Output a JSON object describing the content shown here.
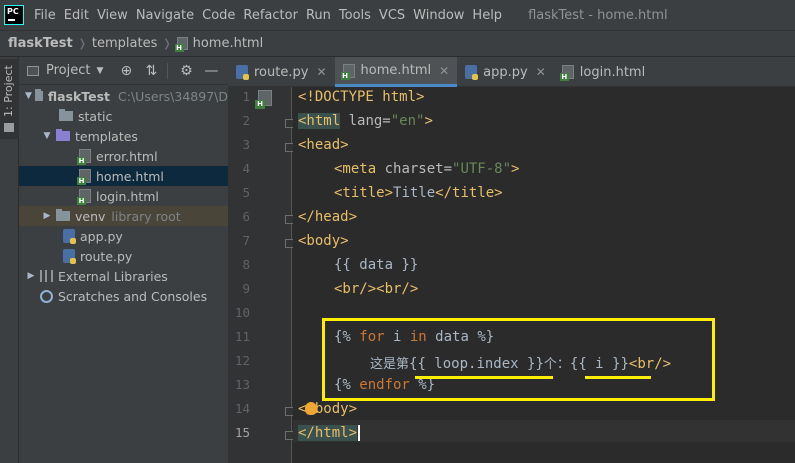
{
  "menubar": {
    "logo": "PC",
    "items": [
      "File",
      "Edit",
      "View",
      "Navigate",
      "Code",
      "Refactor",
      "Run",
      "Tools",
      "VCS",
      "Window",
      "Help"
    ],
    "window_title": "flaskTest - home.html"
  },
  "breadcrumb": {
    "project": "flaskTest",
    "folder": "templates",
    "file": "home.html"
  },
  "toolstrip": {
    "project_tab": "1: Project"
  },
  "project_panel": {
    "title": "Project",
    "root": {
      "name": "flaskTest",
      "path": "C:\\Users\\34897\\D"
    },
    "static": "static",
    "templates": "templates",
    "files": [
      "error.html",
      "home.html",
      "login.html"
    ],
    "venv": "venv",
    "venv_hint": "library root",
    "py_files": [
      "app.py",
      "route.py"
    ],
    "external": "External Libraries",
    "scratches": "Scratches and Consoles"
  },
  "tabs": [
    {
      "label": "route.py",
      "active": false,
      "type": "py"
    },
    {
      "label": "home.html",
      "active": true,
      "type": "html"
    },
    {
      "label": "app.py",
      "active": false,
      "type": "py"
    },
    {
      "label": "login.html",
      "active": false,
      "type": "html"
    }
  ],
  "editor": {
    "line_numbers": [
      "1",
      "2",
      "3",
      "4",
      "5",
      "6",
      "7",
      "8",
      "9",
      "10",
      "11",
      "12",
      "13",
      "14",
      "15"
    ],
    "current_line": 15,
    "code": {
      "l1": "<!DOCTYPE html>",
      "l2_tag": "<html",
      "l2_attr": " lang=",
      "l2_val": "\"en\"",
      "l2_end": ">",
      "l3": "<head>",
      "l4_tag": "<meta",
      "l4_attr": " charset=",
      "l4_val": "\"UTF-8\"",
      "l4_end": ">",
      "l5_open": "<title>",
      "l5_text": "Title",
      "l5_close": "</title>",
      "l6": "</head>",
      "l7": "<body>",
      "l8": "{{ data }}",
      "l9": "<br/><br/>",
      "l11_a": "{%",
      "l11_b": " for ",
      "l11_c": "i ",
      "l11_d": "in",
      "l11_e": " data ",
      "l11_f": "%}",
      "l12_text1": "这是第",
      "l12_expr1": "{{ loop.index }}",
      "l12_text2": "个：",
      "l12_expr2": "{{ i }}",
      "l12_tag": "<br/>",
      "l13_a": "{%",
      "l13_b": " endfor ",
      "l13_c": "%}",
      "l14": "</body>",
      "l15": "</html>"
    }
  },
  "colors": {
    "tag": "#e8bf6a",
    "string": "#6a8759",
    "keyword": "#cc7832",
    "annotation": "#ffee00"
  }
}
